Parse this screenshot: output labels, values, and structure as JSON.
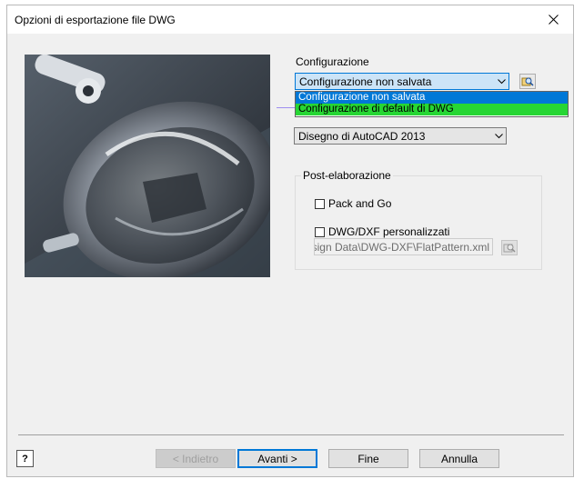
{
  "window": {
    "title": "Opzioni di esportazione file DWG"
  },
  "config": {
    "label": "Configurazione",
    "selected": "Configurazione non salvata",
    "options": [
      "Configurazione non salvata",
      "Configurazione di default di DWG"
    ]
  },
  "format": {
    "selected": "Disegno di AutoCAD 2013"
  },
  "post": {
    "group_label": "Post-elaborazione",
    "pack_label": "Pack and Go",
    "custom_label": "DWG/DXF personalizzati",
    "path_value": "Design Data\\DWG-DXF\\FlatPattern.xml"
  },
  "buttons": {
    "back": "< Indietro",
    "next": "Avanti >",
    "finish": "Fine",
    "cancel": "Annulla",
    "help": "?"
  },
  "icons": {
    "close": "close-icon",
    "config_browse": "magnifier-folder-icon",
    "path_browse": "magnifier-folder-icon",
    "help": "help-icon"
  }
}
